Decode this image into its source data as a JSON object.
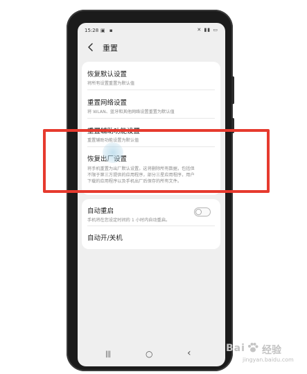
{
  "status_bar": {
    "time": "15:28",
    "left_icons": "▣ ▪",
    "right_icons": "✕ ▮▮ ▭"
  },
  "header": {
    "title": "重置"
  },
  "reset_items": [
    {
      "title": "恢复默认设置",
      "subtitle": "将所有设置重置为默认值"
    },
    {
      "title": "重置网络设置",
      "subtitle": "将 WLAN、蓝牙和其他网络设置重置为默认值"
    },
    {
      "title": "重置辅助功能设置",
      "subtitle": "重置辅助功能设置为默认值"
    },
    {
      "title": "恢复出厂设置",
      "subtitle_lines": [
        "将手机重置为出厂默认设置。这将删除所有数据，包括但",
        "不限于第三方提供的应用程序，部分三星应用程序，用户",
        "下载的应用程序以及手机出厂后保存的所有文件。"
      ]
    }
  ],
  "auto_items": [
    {
      "title": "自动重启",
      "subtitle": "手机将在您设定时间的 1 小时内自动重启。",
      "toggle_on": false
    },
    {
      "title": "自动开/关机"
    }
  ],
  "nav_bar": {
    "recents": "|||",
    "home": "○",
    "back": "‹"
  },
  "watermark": {
    "brand_left": "Bai",
    "brand_right": "经验",
    "url": "jingyan.baidu.com"
  },
  "colors": {
    "highlight": "#e63a2e",
    "screen_bg": "#efefef",
    "card_bg": "#ffffff"
  }
}
